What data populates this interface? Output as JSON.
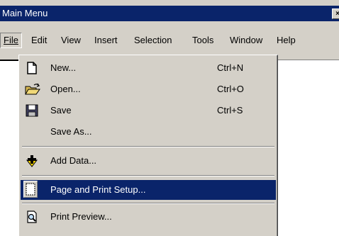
{
  "window": {
    "title": "Main Menu",
    "close_glyph": "×"
  },
  "menubar": {
    "items": [
      {
        "label": "File",
        "active": true
      },
      {
        "label": "Edit"
      },
      {
        "label": "View"
      },
      {
        "label": "Insert"
      },
      {
        "label": "Selection"
      },
      {
        "label": "Tools"
      },
      {
        "label": "Window"
      },
      {
        "label": "Help"
      }
    ]
  },
  "file_menu": {
    "items": [
      {
        "label": "New...",
        "shortcut": "Ctrl+N",
        "icon": "new-document-icon"
      },
      {
        "label": "Open...",
        "shortcut": "Ctrl+O",
        "icon": "open-folder-icon"
      },
      {
        "label": "Save",
        "shortcut": "Ctrl+S",
        "icon": "save-disk-icon"
      },
      {
        "label": "Save As...",
        "shortcut": "",
        "icon": ""
      },
      {
        "label": "Add Data...",
        "shortcut": "",
        "icon": "add-data-icon"
      },
      {
        "label": "Page and Print Setup...",
        "shortcut": "",
        "icon": "page-setup-icon",
        "highlighted": true
      },
      {
        "label": "Print Preview...",
        "shortcut": "",
        "icon": "print-preview-icon"
      }
    ]
  },
  "colors": {
    "title_bar": "#0a246a",
    "menu_face": "#d4d0c8",
    "highlight": "#0a246a"
  }
}
